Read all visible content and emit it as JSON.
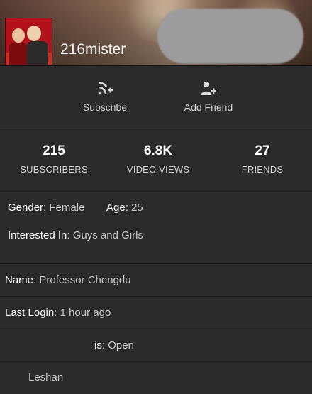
{
  "profile": {
    "username": "216mister"
  },
  "actions": {
    "subscribe_label": "Subscribe",
    "add_friend_label": "Add Friend"
  },
  "stats": [
    {
      "value": "215",
      "caption": "SUBSCRIBERS"
    },
    {
      "value": "6.8K",
      "caption": "VIDEO VIEWS"
    },
    {
      "value": "27",
      "caption": "FRIENDS"
    }
  ],
  "details": {
    "gender_label": "Gender",
    "gender_value": "Female",
    "age_label": "Age",
    "age_value": "25",
    "interested_label": "Interested In",
    "interested_value": "Guys and Girls"
  },
  "rows": {
    "name_label": "Name",
    "name_value": "Professor Chengdu",
    "last_login_label": "Last Login",
    "last_login_value": "1 hour ago",
    "status_label": "is",
    "status_value": "Open",
    "partial_text": "Leshan"
  },
  "icons": {
    "subscribe": "rss-plus-icon",
    "add_friend": "person-plus-icon"
  },
  "colors": {
    "background": "#2a2a2a",
    "text": "#ffffff",
    "muted": "#c8c8c8"
  }
}
